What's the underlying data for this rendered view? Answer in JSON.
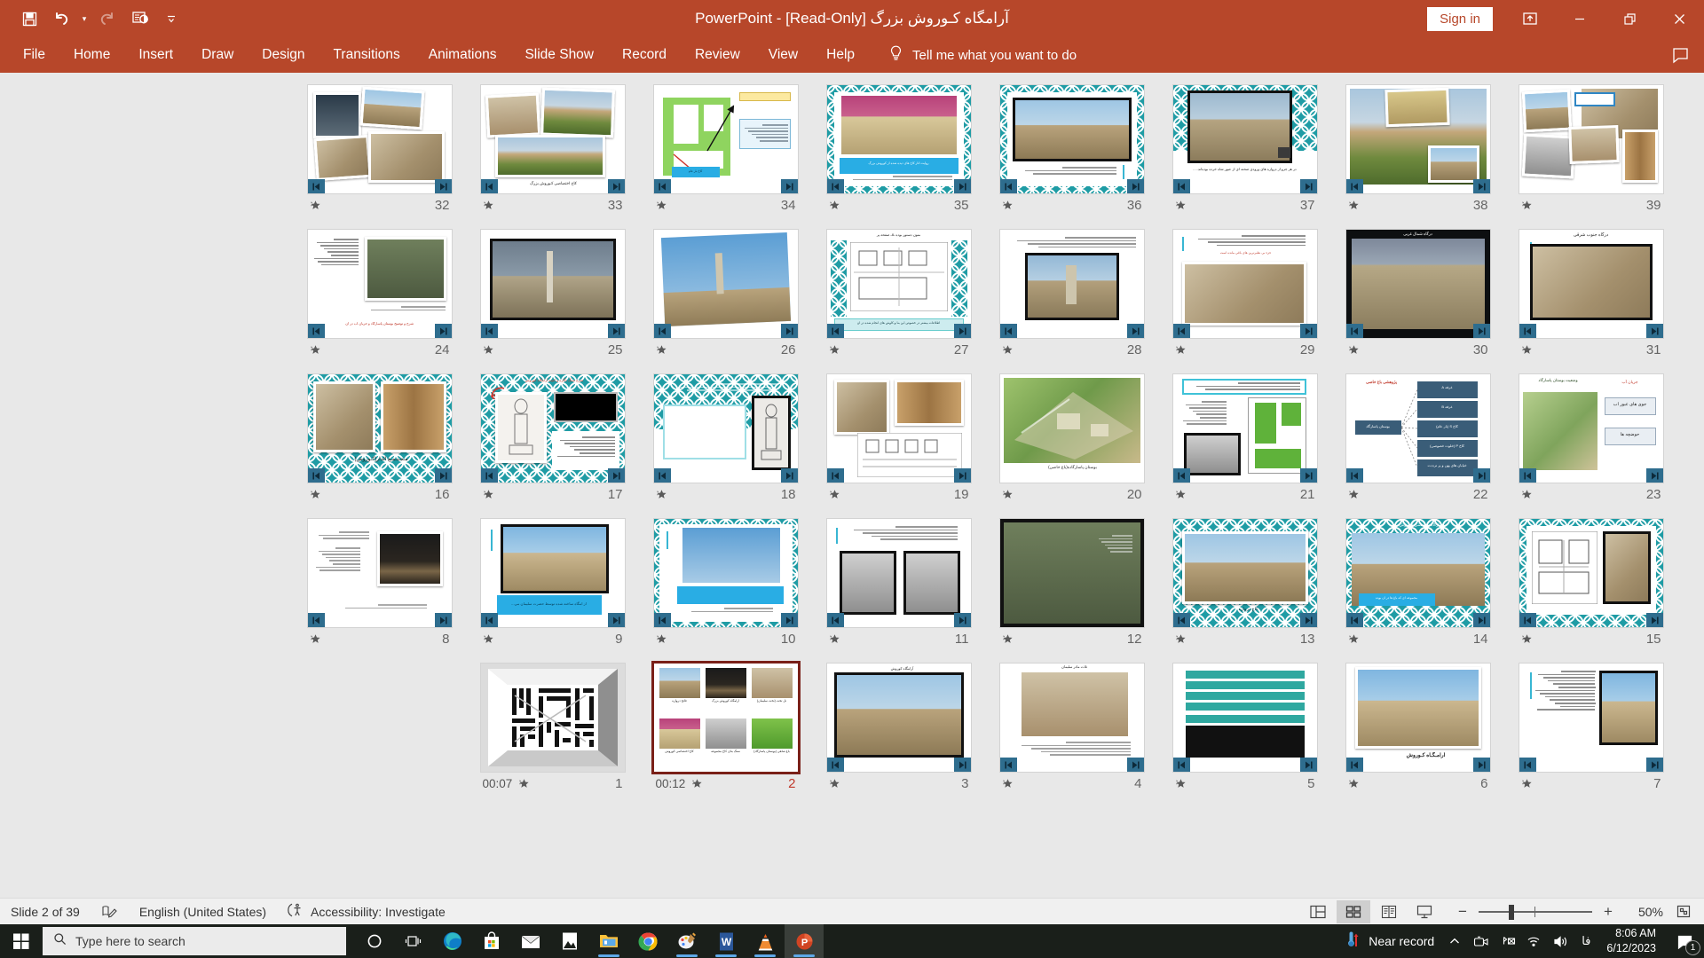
{
  "titlebar": {
    "document_title": "آرامگاه کـوروش بزرگ [Read-Only]  -  PowerPoint",
    "signin_label": "Sign in",
    "qat": [
      {
        "name": "save-icon",
        "label": "Save"
      },
      {
        "name": "undo-icon",
        "label": "Undo"
      },
      {
        "name": "redo-icon",
        "label": "Redo"
      },
      {
        "name": "start-presentation-icon",
        "label": "Start From Beginning"
      },
      {
        "name": "customize-qat-icon",
        "label": "Customize Quick Access Toolbar"
      }
    ],
    "window_buttons": [
      {
        "name": "ribbon-display-options-icon",
        "label": "Ribbon Display Options"
      },
      {
        "name": "minimize-icon",
        "label": "Minimize"
      },
      {
        "name": "restore-icon",
        "label": "Restore Down"
      },
      {
        "name": "close-icon",
        "label": "Close"
      }
    ]
  },
  "ribbon": {
    "tabs": [
      "File",
      "Home",
      "Insert",
      "Draw",
      "Design",
      "Transitions",
      "Animations",
      "Slide Show",
      "Record",
      "Review",
      "View",
      "Help"
    ],
    "tell_me": "Tell me what you want to do",
    "comment_label": "Comments"
  },
  "statusbar": {
    "slide_counter": "Slide 2 of 39",
    "language": "English (United States)",
    "accessibility": "Accessibility: Investigate",
    "views": [
      {
        "name": "normal-view-button",
        "label": "Normal",
        "active": false
      },
      {
        "name": "slide-sorter-view-button",
        "label": "Slide Sorter",
        "active": true
      },
      {
        "name": "reading-view-button",
        "label": "Reading View",
        "active": false
      },
      {
        "name": "slide-show-button",
        "label": "Slide Show",
        "active": false
      }
    ],
    "zoom_level": "50%",
    "zoom_out_label": "−",
    "zoom_in_label": "+",
    "fit_label": "Fit slide to current window"
  },
  "taskbar": {
    "search_placeholder": "Type here to search",
    "weather_text": "Near record",
    "clock_time": "8:06 AM",
    "clock_date": "6/12/2023",
    "language_indicator": "فا",
    "notification_count": "1",
    "apps": [
      {
        "name": "cortana-icon",
        "label": "Cortana"
      },
      {
        "name": "task-view-icon",
        "label": "Task View"
      },
      {
        "name": "edge-icon",
        "label": "Microsoft Edge",
        "running": true
      },
      {
        "name": "microsoft-store-icon",
        "label": "Microsoft Store"
      },
      {
        "name": "mail-icon",
        "label": "Mail"
      },
      {
        "name": "photos-icon",
        "label": "Photos"
      },
      {
        "name": "file-explorer-icon",
        "label": "File Explorer",
        "running": true
      },
      {
        "name": "chrome-icon",
        "label": "Google Chrome",
        "running": true
      },
      {
        "name": "paint-icon",
        "label": "Paint",
        "running": true
      },
      {
        "name": "word-icon",
        "label": "Microsoft Word",
        "running": true
      },
      {
        "name": "vlc-icon",
        "label": "VLC Media Player",
        "running": true
      },
      {
        "name": "powerpoint-icon",
        "label": "Microsoft PowerPoint",
        "running": true,
        "active": true
      }
    ],
    "tray": [
      {
        "name": "show-hidden-icons-icon",
        "label": "Show hidden icons"
      },
      {
        "name": "camera-icon",
        "label": "Camera"
      },
      {
        "name": "bluetooth-off-icon",
        "label": "Bluetooth off"
      },
      {
        "name": "wifi-icon",
        "label": "Network"
      },
      {
        "name": "volume-icon",
        "label": "Volume"
      }
    ]
  },
  "slide_sorter": {
    "selected_slide": 2,
    "total_slides": 39,
    "slides": [
      {
        "number": 1,
        "timing": "00:07",
        "animated": true,
        "layout": "kufic"
      },
      {
        "number": 2,
        "timing": "00:12",
        "animated": true,
        "layout": "grid6",
        "selected": true
      },
      {
        "number": 3,
        "timing": "",
        "animated": true,
        "layout": "photoBox"
      },
      {
        "number": 4,
        "timing": "",
        "animated": true,
        "layout": "textPhoto"
      },
      {
        "number": 5,
        "timing": "",
        "animated": true,
        "layout": "bandsBlack"
      },
      {
        "number": 6,
        "timing": "",
        "animated": true,
        "layout": "tombTitle"
      },
      {
        "number": 7,
        "timing": "",
        "animated": true,
        "layout": "textSide"
      },
      {
        "number": 8,
        "timing": "",
        "animated": true,
        "layout": "nightTomb"
      },
      {
        "number": 9,
        "timing": "",
        "animated": true,
        "layout": "tombCaption"
      },
      {
        "number": 10,
        "timing": "",
        "animated": true,
        "layout": "tealPhotoBar"
      },
      {
        "number": 11,
        "timing": "",
        "animated": true,
        "layout": "twoOldPhotos"
      },
      {
        "number": 12,
        "timing": "",
        "animated": true,
        "layout": "aerialDark"
      },
      {
        "number": 13,
        "timing": "",
        "animated": true,
        "layout": "tealLandscape"
      },
      {
        "number": 14,
        "timing": "",
        "animated": true,
        "layout": "tealLandscapeCap"
      },
      {
        "number": 15,
        "timing": "",
        "animated": true,
        "layout": "tealPlans"
      },
      {
        "number": 16,
        "timing": "",
        "animated": true,
        "layout": "tealReliefs"
      },
      {
        "number": 17,
        "timing": "",
        "animated": true,
        "layout": "tealStatueBlack"
      },
      {
        "number": 18,
        "timing": "",
        "animated": true,
        "layout": "tealBlankStatue"
      },
      {
        "number": 19,
        "timing": "",
        "animated": true,
        "layout": "reliefPlan"
      },
      {
        "number": 20,
        "timing": "",
        "animated": true,
        "layout": "gardenMap"
      },
      {
        "number": 21,
        "timing": "",
        "animated": true,
        "layout": "greenPlan"
      },
      {
        "number": 22,
        "timing": "",
        "animated": true,
        "layout": "diagram"
      },
      {
        "number": 23,
        "timing": "",
        "animated": true,
        "layout": "waterDiagram"
      },
      {
        "number": 24,
        "timing": "",
        "animated": true,
        "layout": "aerialText"
      },
      {
        "number": 25,
        "timing": "",
        "animated": true,
        "layout": "pillarBlack"
      },
      {
        "number": 26,
        "timing": "",
        "animated": true,
        "layout": "pillarTilt"
      },
      {
        "number": 27,
        "timing": "",
        "animated": true,
        "layout": "planTeal"
      },
      {
        "number": 28,
        "timing": "",
        "animated": true,
        "layout": "textTower"
      },
      {
        "number": 29,
        "timing": "",
        "animated": true,
        "layout": "reliefText"
      },
      {
        "number": 30,
        "timing": "",
        "animated": true,
        "layout": "wallDark"
      },
      {
        "number": 31,
        "timing": "",
        "animated": true,
        "layout": "reliefTitle"
      },
      {
        "number": 32,
        "timing": "",
        "animated": true,
        "layout": "photoCollage1"
      },
      {
        "number": 33,
        "timing": "",
        "animated": true,
        "layout": "poppyCollage"
      },
      {
        "number": 34,
        "timing": "",
        "animated": true,
        "layout": "greenMapArrows"
      },
      {
        "number": 35,
        "timing": "",
        "animated": true,
        "layout": "tealPinkRuins"
      },
      {
        "number": 36,
        "timing": "",
        "animated": true,
        "layout": "tealRuins"
      },
      {
        "number": 37,
        "timing": "",
        "animated": true,
        "layout": "tealColumnsCap"
      },
      {
        "number": 38,
        "timing": "",
        "animated": true,
        "layout": "columnsPoppy"
      },
      {
        "number": 39,
        "timing": "",
        "animated": true,
        "layout": "photoCollage2"
      }
    ]
  }
}
